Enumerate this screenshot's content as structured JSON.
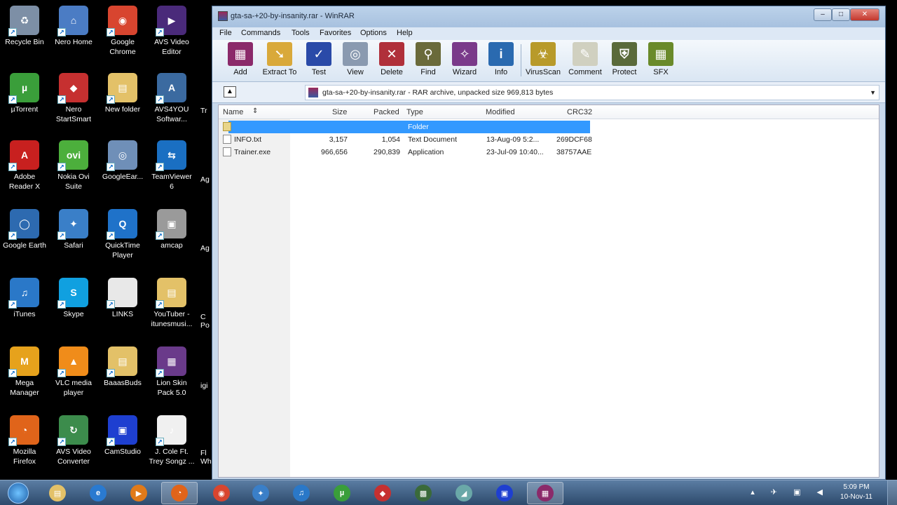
{
  "desktop": {
    "icons": [
      {
        "label": "Recycle Bin",
        "icon": "recycle-bin-icon",
        "color": "#7d8fa6",
        "glyph": "♻"
      },
      {
        "label": "Nero Home",
        "icon": "nero-home-icon",
        "color": "#4b7cc4",
        "glyph": "⌂"
      },
      {
        "label": "Google\nChrome",
        "icon": "chrome-icon",
        "color": "#d8452f",
        "glyph": "◉"
      },
      {
        "label": "AVS Video\nEditor",
        "icon": "avs-video-editor-icon",
        "color": "#4a2a7a",
        "glyph": "▶"
      },
      {
        "label": "µTorrent",
        "icon": "utorrent-icon",
        "color": "#3a9e3a",
        "glyph": "µ"
      },
      {
        "label": "Nero\nStartSmart",
        "icon": "nero-startsmart-icon",
        "color": "#c63030",
        "glyph": "◆"
      },
      {
        "label": "New folder",
        "icon": "folder-icon",
        "color": "#e3c168",
        "glyph": "▤"
      },
      {
        "label": "AVS4YOU\nSoftwar...",
        "icon": "avs4you-icon",
        "color": "#3b6aa0",
        "glyph": "A"
      },
      {
        "label": "Adobe\nReader X",
        "icon": "adobe-reader-icon",
        "color": "#c8201f",
        "glyph": "A"
      },
      {
        "label": "Nokia Ovi\nSuite",
        "icon": "nokia-ovi-icon",
        "color": "#4caf3c",
        "glyph": "ovi"
      },
      {
        "label": "GoogleEar...",
        "icon": "google-earth-shortcut-icon",
        "color": "#6f8fb8",
        "glyph": "◎"
      },
      {
        "label": "TeamViewer\n6",
        "icon": "teamviewer-icon",
        "color": "#1a6fc2",
        "glyph": "⇆"
      },
      {
        "label": "Google Earth",
        "icon": "google-earth-icon",
        "color": "#2d6ab0",
        "glyph": "◯"
      },
      {
        "label": "Safari",
        "icon": "safari-icon",
        "color": "#3a7fc8",
        "glyph": "✦"
      },
      {
        "label": "QuickTime\nPlayer",
        "icon": "quicktime-icon",
        "color": "#1f72c9",
        "glyph": "Q"
      },
      {
        "label": "amcap",
        "icon": "amcap-icon",
        "color": "#9a9a9a",
        "glyph": "▣"
      },
      {
        "label": "iTunes",
        "icon": "itunes-icon",
        "color": "#2a78c8",
        "glyph": "♫"
      },
      {
        "label": "Skype",
        "icon": "skype-icon",
        "color": "#10a0e0",
        "glyph": "S"
      },
      {
        "label": "LINKS",
        "icon": "text-file-icon",
        "color": "#e8e8e8",
        "glyph": ""
      },
      {
        "label": "YouTuber -\nitunesmusi...",
        "icon": "folder-icon",
        "color": "#e3c168",
        "glyph": "▤"
      },
      {
        "label": "Mega\nManager",
        "icon": "mega-manager-icon",
        "color": "#e6a21c",
        "glyph": "M"
      },
      {
        "label": "VLC media\nplayer",
        "icon": "vlc-icon",
        "color": "#f08c1a",
        "glyph": "▲"
      },
      {
        "label": "BaaasBuds",
        "icon": "folder-icon",
        "color": "#e3c168",
        "glyph": "▤"
      },
      {
        "label": "Lion Skin\nPack 5.0",
        "icon": "winrar-archive-icon",
        "color": "#6a3a8a",
        "glyph": "▦"
      },
      {
        "label": "Mozilla\nFirefox",
        "icon": "firefox-icon",
        "color": "#e0641a",
        "glyph": "◔"
      },
      {
        "label": "AVS Video\nConverter",
        "icon": "avs-video-converter-icon",
        "color": "#3c8c4c",
        "glyph": "↻"
      },
      {
        "label": "CamStudio",
        "icon": "camstudio-icon",
        "color": "#1e3fd0",
        "glyph": "▣"
      },
      {
        "label": "J. Cole Ft.\nTrey Songz ...",
        "icon": "mp3-file-icon",
        "color": "#f0f0f0",
        "glyph": "♪"
      }
    ],
    "partial_labels": [
      "Tr",
      "Ag",
      "Ag",
      "C\nPo",
      "igi",
      "Fl\nWh"
    ]
  },
  "window": {
    "title": "gta-sa-+20-by-insanity.rar - WinRAR",
    "controls": {
      "minimize": "–",
      "maximize": "□",
      "close": "✕"
    },
    "menu": [
      "File",
      "Commands",
      "Tools",
      "Favorites",
      "Options",
      "Help"
    ],
    "toolbar": [
      {
        "label": "Add",
        "icon": "add-icon",
        "color": "#8b2a6a",
        "glyph": "▦"
      },
      {
        "label": "Extract To",
        "icon": "extract-to-icon",
        "color": "#d9a93a",
        "glyph": "➘"
      },
      {
        "label": "Test",
        "icon": "test-icon",
        "color": "#2a4aa8",
        "glyph": "✓"
      },
      {
        "label": "View",
        "icon": "view-icon",
        "color": "#8a9ab0",
        "glyph": "◎"
      },
      {
        "label": "Delete",
        "icon": "delete-icon",
        "color": "#b0303a",
        "glyph": "✕"
      },
      {
        "label": "Find",
        "icon": "find-icon",
        "color": "#6a6a3a",
        "glyph": "⚲"
      },
      {
        "label": "Wizard",
        "icon": "wizard-icon",
        "color": "#7a3a8a",
        "glyph": "✧"
      },
      {
        "label": "Info",
        "icon": "info-icon",
        "color": "#2a6ab0",
        "glyph": "i"
      },
      {
        "label": "VirusScan",
        "icon": "virusscan-icon",
        "color": "#b89a2a",
        "glyph": "☣"
      },
      {
        "label": "Comment",
        "icon": "comment-icon",
        "color": "#d0d0c0",
        "glyph": "✎"
      },
      {
        "label": "Protect",
        "icon": "protect-icon",
        "color": "#5a6a3a",
        "glyph": "⛨"
      },
      {
        "label": "SFX",
        "icon": "sfx-icon",
        "color": "#6a8a2a",
        "glyph": "▦"
      }
    ],
    "path": "gta-sa-+20-by-insanity.rar - RAR archive, unpacked size 969,813 bytes",
    "columns": {
      "name": "Name",
      "size": "Size",
      "packed": "Packed",
      "type": "Type",
      "modified": "Modified",
      "crc": "CRC32"
    },
    "rows": [
      {
        "name": "",
        "size": "",
        "packed": "",
        "type": "Folder",
        "modified": "",
        "crc": "",
        "selected": true
      },
      {
        "name": "INFO.txt",
        "size": "3,157",
        "packed": "1,054",
        "type": "Text Document",
        "modified": "13-Aug-09 5:2...",
        "crc": "269DCF68",
        "selected": false
      },
      {
        "name": "Trainer.exe",
        "size": "966,656",
        "packed": "290,839",
        "type": "Application",
        "modified": "23-Jul-09 10:40...",
        "crc": "38757AAE",
        "selected": false
      }
    ]
  },
  "taskbar": {
    "apps": [
      {
        "icon": "explorer-icon",
        "color": "#e3c168",
        "glyph": "▤",
        "active": false
      },
      {
        "icon": "internet-explorer-icon",
        "color": "#2a7ad0",
        "glyph": "e",
        "active": false
      },
      {
        "icon": "media-player-icon",
        "color": "#e07a1a",
        "glyph": "▶",
        "active": false
      },
      {
        "icon": "firefox-icon",
        "color": "#e0641a",
        "glyph": "◔",
        "active": true
      },
      {
        "icon": "chrome-icon",
        "color": "#d8452f",
        "glyph": "◉",
        "active": false
      },
      {
        "icon": "safari-icon",
        "color": "#3a7fc8",
        "glyph": "✦",
        "active": false
      },
      {
        "icon": "itunes-icon",
        "color": "#2a78c8",
        "glyph": "♫",
        "active": false
      },
      {
        "icon": "utorrent-icon",
        "color": "#3a9e3a",
        "glyph": "µ",
        "active": false
      },
      {
        "icon": "nero-icon",
        "color": "#c63030",
        "glyph": "◆",
        "active": false
      },
      {
        "icon": "games-icon",
        "color": "#3a6a3a",
        "glyph": "▩",
        "active": false
      },
      {
        "icon": "snipping-icon",
        "color": "#6aa8a8",
        "glyph": "◢",
        "active": false
      },
      {
        "icon": "camstudio-icon",
        "color": "#1e3fd0",
        "glyph": "▣",
        "active": false
      },
      {
        "icon": "winrar-icon",
        "color": "#8b2a6a",
        "glyph": "▦",
        "active": true
      }
    ],
    "tray": "▴ ✈ ▣ ◀",
    "time": "5:09 PM",
    "date": "10-Nov-11"
  }
}
